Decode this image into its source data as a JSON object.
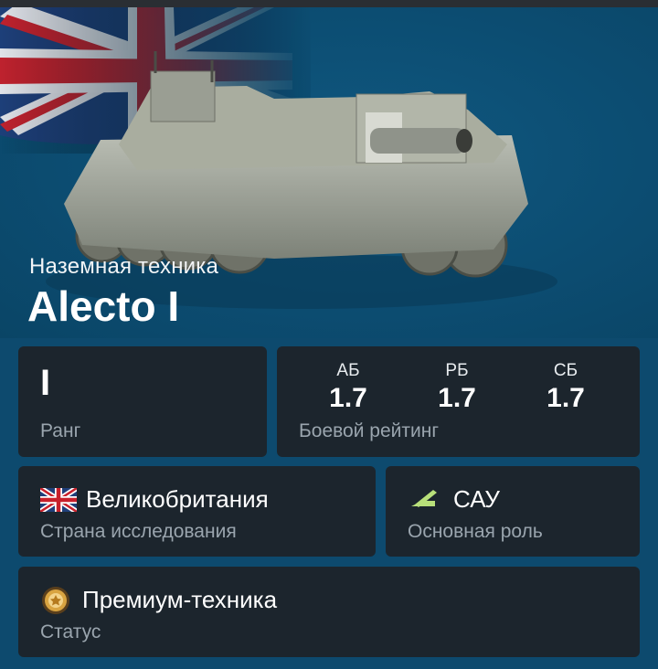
{
  "vehicle": {
    "category": "Наземная техника",
    "name": "Alecto I"
  },
  "rank": {
    "value": "I",
    "label": "Ранг"
  },
  "battle_rating": {
    "label": "Боевой рейтинг",
    "modes": [
      {
        "mode": "АБ",
        "value": "1.7"
      },
      {
        "mode": "РБ",
        "value": "1.7"
      },
      {
        "mode": "СБ",
        "value": "1.7"
      }
    ]
  },
  "country": {
    "value": "Великобритания",
    "label": "Страна исследования",
    "icon": "uk-flag-icon"
  },
  "role": {
    "value": "САУ",
    "label": "Основная роль",
    "icon": "spg-role-icon",
    "accent": "#b8e07a"
  },
  "status": {
    "value": "Премиум-техника",
    "label": "Статус",
    "icon": "premium-medal-icon"
  },
  "colors": {
    "background": "#0d4a6e",
    "card": "#1c252d",
    "label": "#9aa5ae"
  }
}
